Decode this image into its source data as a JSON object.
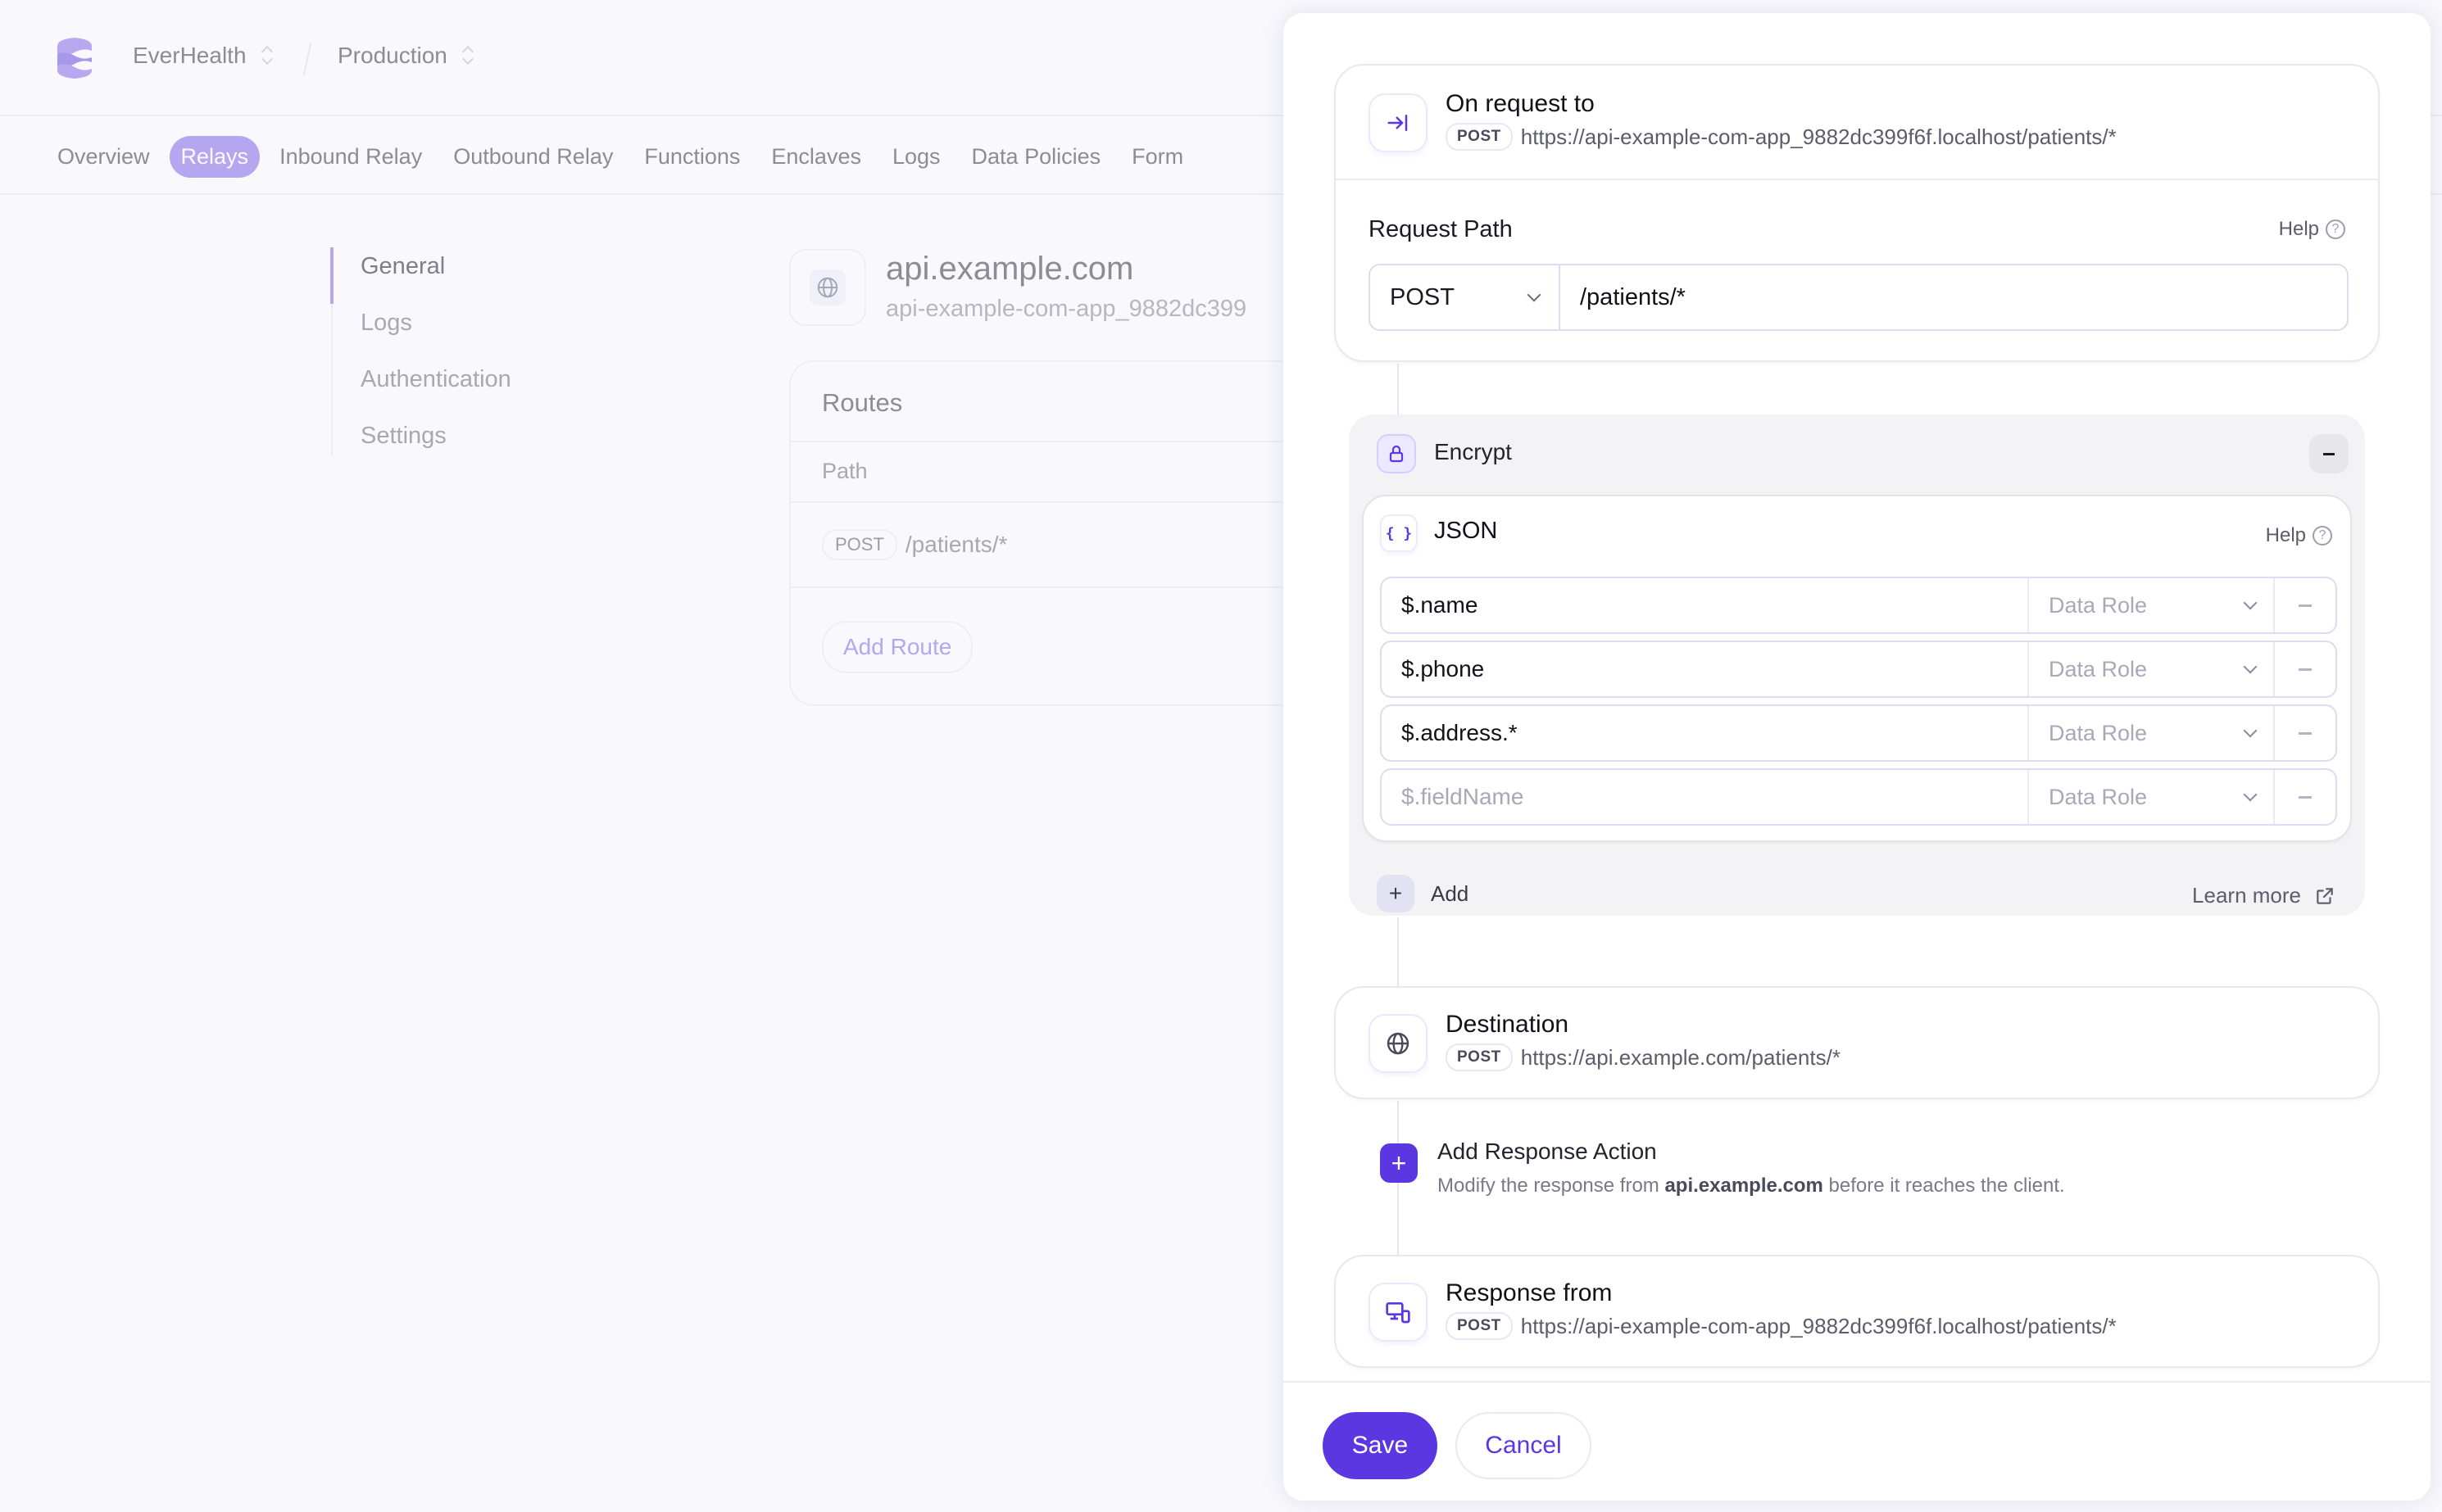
{
  "header": {
    "org": "EverHealth",
    "environment": "Production"
  },
  "nav": {
    "tabs": [
      {
        "label": "Overview",
        "active": false
      },
      {
        "label": "Relays",
        "active": true
      },
      {
        "label": "Inbound Relay",
        "active": false
      },
      {
        "label": "Outbound Relay",
        "active": false
      },
      {
        "label": "Functions",
        "active": false
      },
      {
        "label": "Enclaves",
        "active": false
      },
      {
        "label": "Logs",
        "active": false
      },
      {
        "label": "Data Policies",
        "active": false
      },
      {
        "label": "Form",
        "active": false
      }
    ]
  },
  "subnav": {
    "items": [
      {
        "label": "General",
        "active": true
      },
      {
        "label": "Logs",
        "active": false
      },
      {
        "label": "Authentication",
        "active": false
      },
      {
        "label": "Settings",
        "active": false
      }
    ]
  },
  "relay": {
    "title": "api.example.com",
    "subtitle": "api-example-com-app_9882dc399"
  },
  "routes": {
    "title": "Routes",
    "column": "Path",
    "rows": [
      {
        "method": "POST",
        "path": "/patients/*"
      }
    ],
    "add_label": "Add Route"
  },
  "drawer": {
    "on_request": {
      "title": "On request to",
      "method": "POST",
      "url": "https://api-example-com-app_9882dc399f6f.localhost/patients/*"
    },
    "request_path": {
      "label": "Request Path",
      "help": "Help",
      "method": "POST",
      "path": "/patients/*"
    },
    "encrypt": {
      "title": "Encrypt",
      "json_title": "JSON",
      "help": "Help",
      "fields": [
        {
          "value": "$.name",
          "role_placeholder": "Data Role"
        },
        {
          "value": "$.phone",
          "role_placeholder": "Data Role"
        },
        {
          "value": "$.address.*",
          "role_placeholder": "Data Role"
        },
        {
          "value": "",
          "placeholder": "$.fieldName",
          "role_placeholder": "Data Role"
        }
      ],
      "add_label": "Add",
      "learn_more": "Learn more"
    },
    "destination": {
      "title": "Destination",
      "method": "POST",
      "url": "https://api.example.com/patients/*"
    },
    "add_response_action": {
      "title": "Add Response Action",
      "desc_before": "Modify the response from ",
      "desc_host": "api.example.com",
      "desc_after": " before it reaches the client."
    },
    "response_from": {
      "title": "Response from",
      "method": "POST",
      "url": "https://api-example-com-app_9882dc399f6f.localhost/patients/*"
    },
    "footer": {
      "save": "Save",
      "cancel": "Cancel"
    }
  },
  "colors": {
    "accent": "#5b37e2",
    "accent_muted": "#b5a7ef",
    "encrypt_bg": "#f3f3f5"
  }
}
